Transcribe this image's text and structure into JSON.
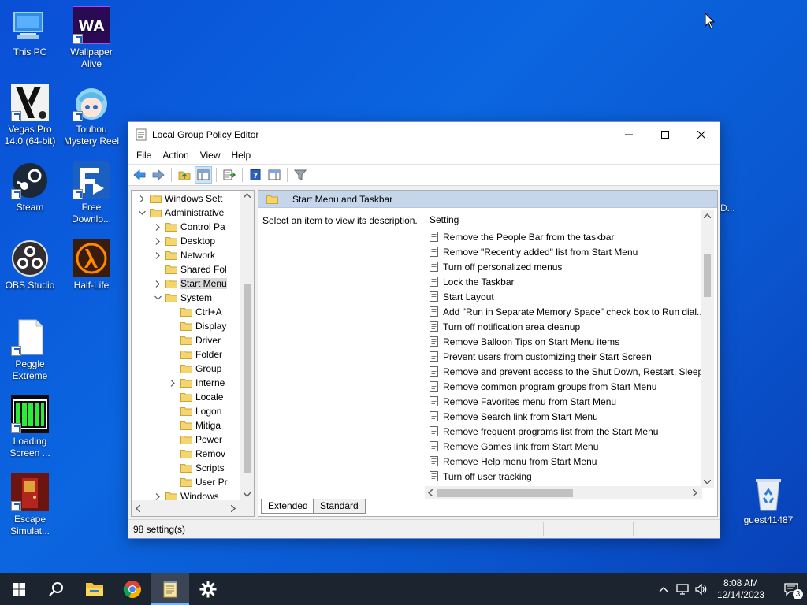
{
  "desktop": {
    "icons": [
      {
        "label": "This PC"
      },
      {
        "label": "Wallpaper Alive"
      },
      {
        "label": "Vegas Pro 14.0 (64-bit)"
      },
      {
        "label": "Touhou Mystery Reel"
      },
      {
        "label": "Steam"
      },
      {
        "label": "Free Downlo..."
      },
      {
        "label": "OBS Studio"
      },
      {
        "label": "Half-Life"
      },
      {
        "label": "Peggle Extreme"
      },
      {
        "label": "Loading Screen ..."
      },
      {
        "label": "Escape Simulat..."
      },
      {
        "label": "guest41487"
      }
    ],
    "hidden_label": "D..."
  },
  "window": {
    "title": "Local Group Policy Editor",
    "menu": [
      "File",
      "Action",
      "View",
      "Help"
    ],
    "tree": [
      {
        "label": "Windows Sett",
        "level": 1,
        "arrow": "right"
      },
      {
        "label": "Administrative",
        "level": 1,
        "arrow": "down"
      },
      {
        "label": "Control Pa",
        "level": 2,
        "arrow": "right"
      },
      {
        "label": "Desktop",
        "level": 2,
        "arrow": "right"
      },
      {
        "label": "Network",
        "level": 2,
        "arrow": "right"
      },
      {
        "label": "Shared Fol",
        "level": 2,
        "arrow": ""
      },
      {
        "label": "Start Menu",
        "level": 2,
        "arrow": "right",
        "selected": true
      },
      {
        "label": "System",
        "level": 2,
        "arrow": "down"
      },
      {
        "label": "Ctrl+A",
        "level": 3,
        "arrow": ""
      },
      {
        "label": "Display",
        "level": 3,
        "arrow": ""
      },
      {
        "label": "Driver",
        "level": 3,
        "arrow": ""
      },
      {
        "label": "Folder",
        "level": 3,
        "arrow": ""
      },
      {
        "label": "Group",
        "level": 3,
        "arrow": ""
      },
      {
        "label": "Interne",
        "level": 3,
        "arrow": "right"
      },
      {
        "label": "Locale",
        "level": 3,
        "arrow": ""
      },
      {
        "label": "Logon",
        "level": 3,
        "arrow": ""
      },
      {
        "label": "Mitiga",
        "level": 3,
        "arrow": ""
      },
      {
        "label": "Power",
        "level": 3,
        "arrow": ""
      },
      {
        "label": "Remov",
        "level": 3,
        "arrow": ""
      },
      {
        "label": "Scripts",
        "level": 3,
        "arrow": ""
      },
      {
        "label": "User Pr",
        "level": 3,
        "arrow": ""
      },
      {
        "label": "Windows",
        "level": 2,
        "arrow": "right"
      }
    ],
    "header": "Start Menu and Taskbar",
    "description": "Select an item to view its description.",
    "list_header": "Setting",
    "settings": [
      "Remove the People Bar from the taskbar",
      "Remove \"Recently added\" list from Start Menu",
      "Turn off personalized menus",
      "Lock the Taskbar",
      "Start Layout",
      "Add \"Run in Separate Memory Space\" check box to Run dial...",
      "Turn off notification area cleanup",
      "Remove Balloon Tips on Start Menu items",
      "Prevent users from customizing their Start Screen",
      "Remove and prevent access to the Shut Down, Restart, Sleep...",
      "Remove common program groups from Start Menu",
      "Remove Favorites menu from Start Menu",
      "Remove Search link from Start Menu",
      "Remove frequent programs list from the Start Menu",
      "Remove Games link from Start Menu",
      "Remove Help menu from Start Menu",
      "Turn off user tracking"
    ],
    "tabs": [
      "Extended",
      "Standard"
    ],
    "status": "98 setting(s)"
  },
  "taskbar": {
    "time": "8:08 AM",
    "date": "12/14/2023",
    "notification_count": "3"
  }
}
